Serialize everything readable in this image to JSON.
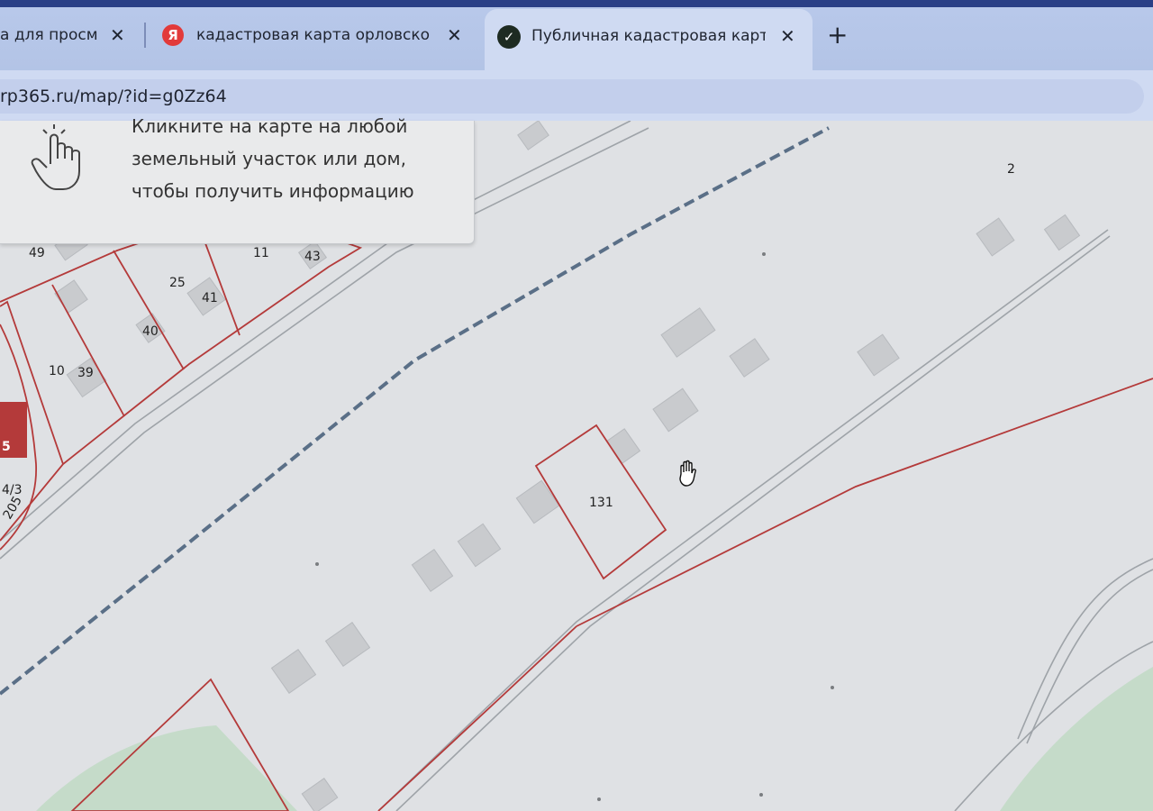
{
  "browser": {
    "tabs": [
      {
        "title": "а для просм",
        "favicon": "none",
        "active": false
      },
      {
        "title": "кадастровая карта орловской",
        "favicon": "Я",
        "active": false
      },
      {
        "title": "Публичная кадастровая карта",
        "favicon": "✓",
        "active": true
      }
    ],
    "close_label": "✕",
    "new_tab_label": "+",
    "url": "rp365.ru/map/?id=g0Zz64"
  },
  "info_panel": {
    "lines": [
      "Кликните на карте на любой",
      "земельный участок или дом,",
      "чтобы получить информацию"
    ]
  },
  "map": {
    "labels": [
      "2",
      "49",
      "11",
      "43",
      "25",
      "41",
      "40",
      "10",
      "39",
      "131",
      "4/3",
      "205",
      "5"
    ],
    "colors": {
      "background": "#dfe1e4",
      "parcel_border": "#b43a3a",
      "building": "#c9cbce",
      "road": "#9ea3a8",
      "railway": "#5a6f87",
      "green_area": "#b9d8bd"
    }
  }
}
